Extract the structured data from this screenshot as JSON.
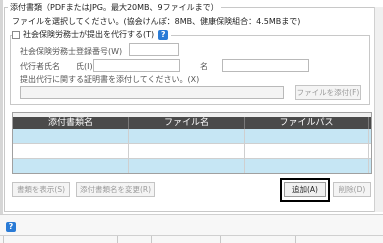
{
  "attachment": {
    "title": "添付書類（PDFまたはJPG。最大20MB、9ファイルまで）",
    "note": "ファイルを選択してください。(協会けんぽ：8MB、健康保険組合：4.5MBまで)"
  },
  "agent": {
    "checkbox_label": "社会保険労務士が提出を代行する(T)",
    "checked": false,
    "reg_number_label": "社会保険労務士登録番号(W)",
    "reg_number_value": "",
    "name_label": "代行者氏名",
    "surname_label": "氏(I)",
    "surname_value": "",
    "given_label": "名",
    "given_value": "",
    "proof_label": "提出代行に関する証明書を添付してください。(X)",
    "proof_value": "",
    "attach_proof_button": "ファイルを添付(F)"
  },
  "table": {
    "columns": [
      "添付書類名",
      "ファイル名",
      "ファイルパス"
    ],
    "rows": [
      {
        "doc_name": "",
        "file_name": "",
        "file_path": "",
        "selected": true
      },
      {
        "doc_name": "",
        "file_name": "",
        "file_path": "",
        "selected": false
      },
      {
        "doc_name": "",
        "file_name": "",
        "file_path": "",
        "selected": true
      }
    ]
  },
  "buttons": {
    "show": "書類を表示(S)",
    "rename": "添付書類名を変更(R)",
    "add": "追加(A)",
    "delete": "削除(D)"
  },
  "help_icon": "?",
  "colors": {
    "header_bg": "#4a4a4a",
    "selected_row": "#c6e6f4",
    "help_blue": "#2a7bd6"
  }
}
